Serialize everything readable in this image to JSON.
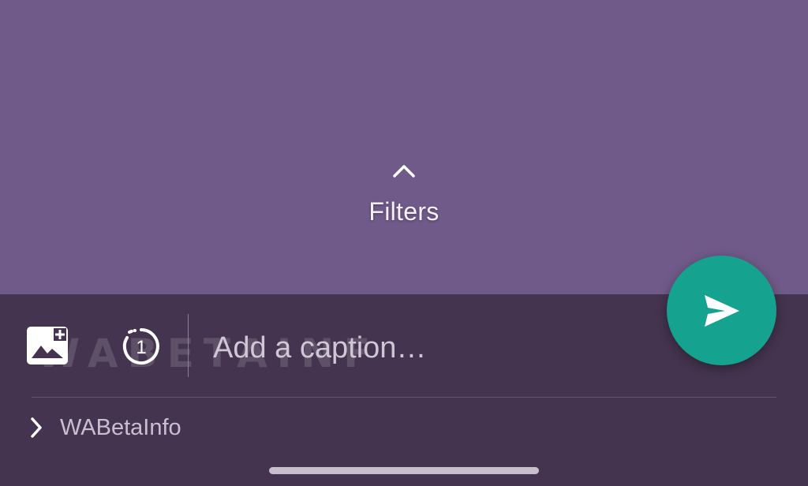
{
  "preview": {
    "background": "#705a89",
    "filters": {
      "label": "Filters",
      "icon": "chevron-up-icon"
    }
  },
  "composer": {
    "background": "#44344f",
    "add_media_icon": "add-photo-icon",
    "view_once": {
      "icon": "view-once-icon",
      "number": "1"
    },
    "caption": {
      "placeholder": "Add a caption…",
      "value": ""
    },
    "watermark": "WABETAINFO",
    "send_button": {
      "icon": "send-icon",
      "color": "#15a38f"
    },
    "recipients": {
      "icon": "chevron-right-icon",
      "label": "WABetaInfo"
    }
  }
}
